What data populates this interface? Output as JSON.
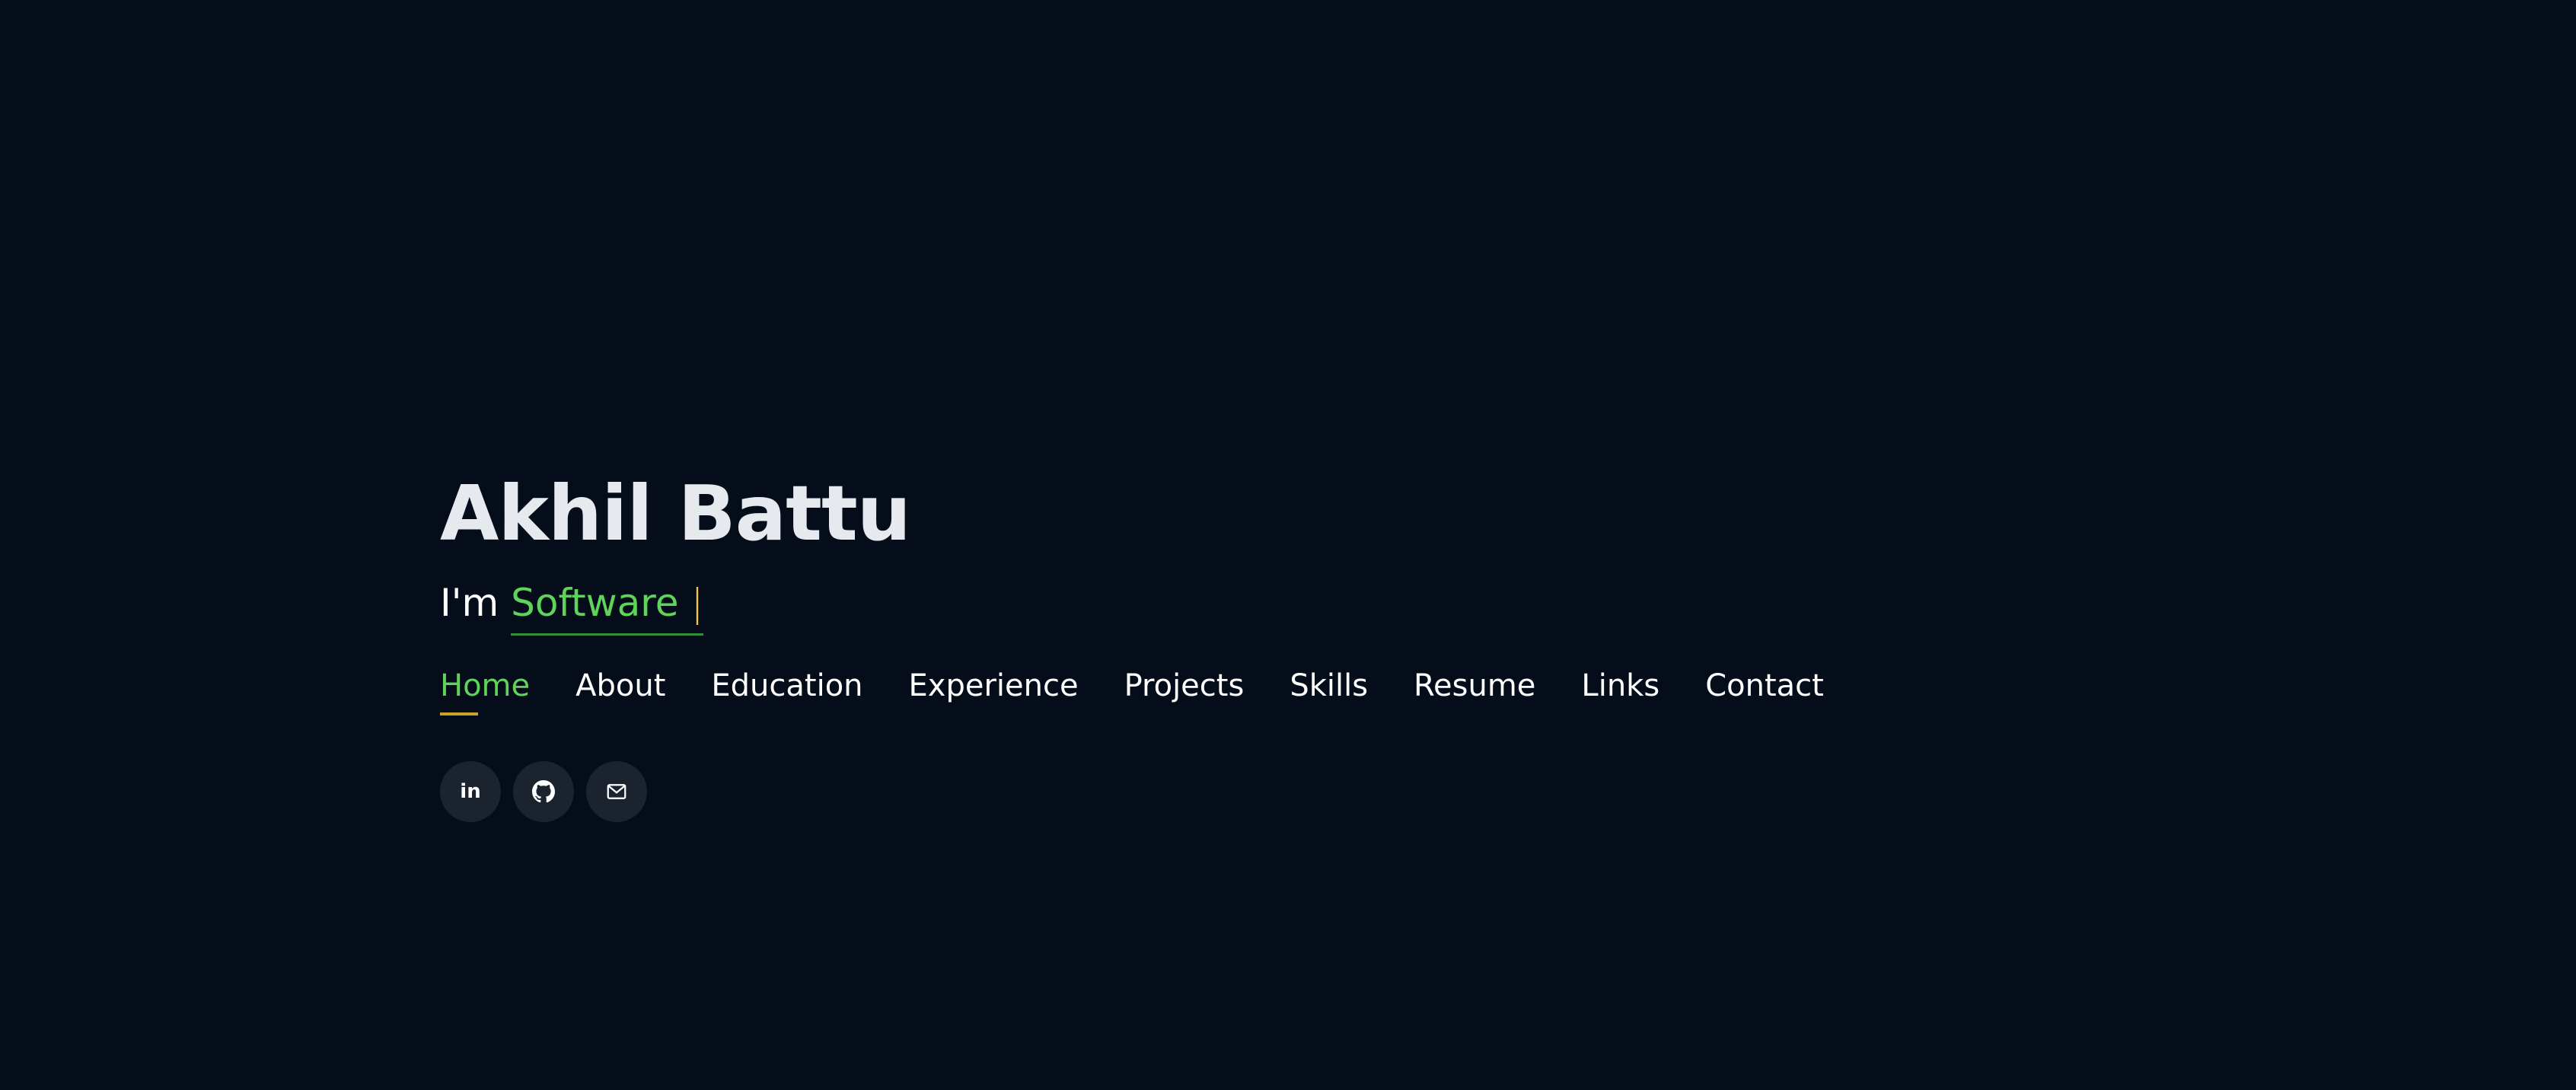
{
  "hero": {
    "name": "Akhil Battu",
    "typed_prefix": "I'm",
    "typed_word": "Software",
    "cursor": "|"
  },
  "nav": {
    "items": [
      {
        "label": "Home",
        "active": true
      },
      {
        "label": "About"
      },
      {
        "label": "Education"
      },
      {
        "label": "Experience"
      },
      {
        "label": "Projects"
      },
      {
        "label": "Skills"
      },
      {
        "label": "Resume"
      },
      {
        "label": "Links"
      },
      {
        "label": "Contact"
      }
    ]
  },
  "socials": [
    {
      "icon": "linkedin-icon",
      "glyph": "in"
    },
    {
      "icon": "github-icon"
    },
    {
      "icon": "mail-icon"
    }
  ],
  "colors": {
    "background": "#040d19",
    "accent_green": "#5fd35a",
    "accent_gold": "#c9a227",
    "social_bg": "#1b232f"
  }
}
